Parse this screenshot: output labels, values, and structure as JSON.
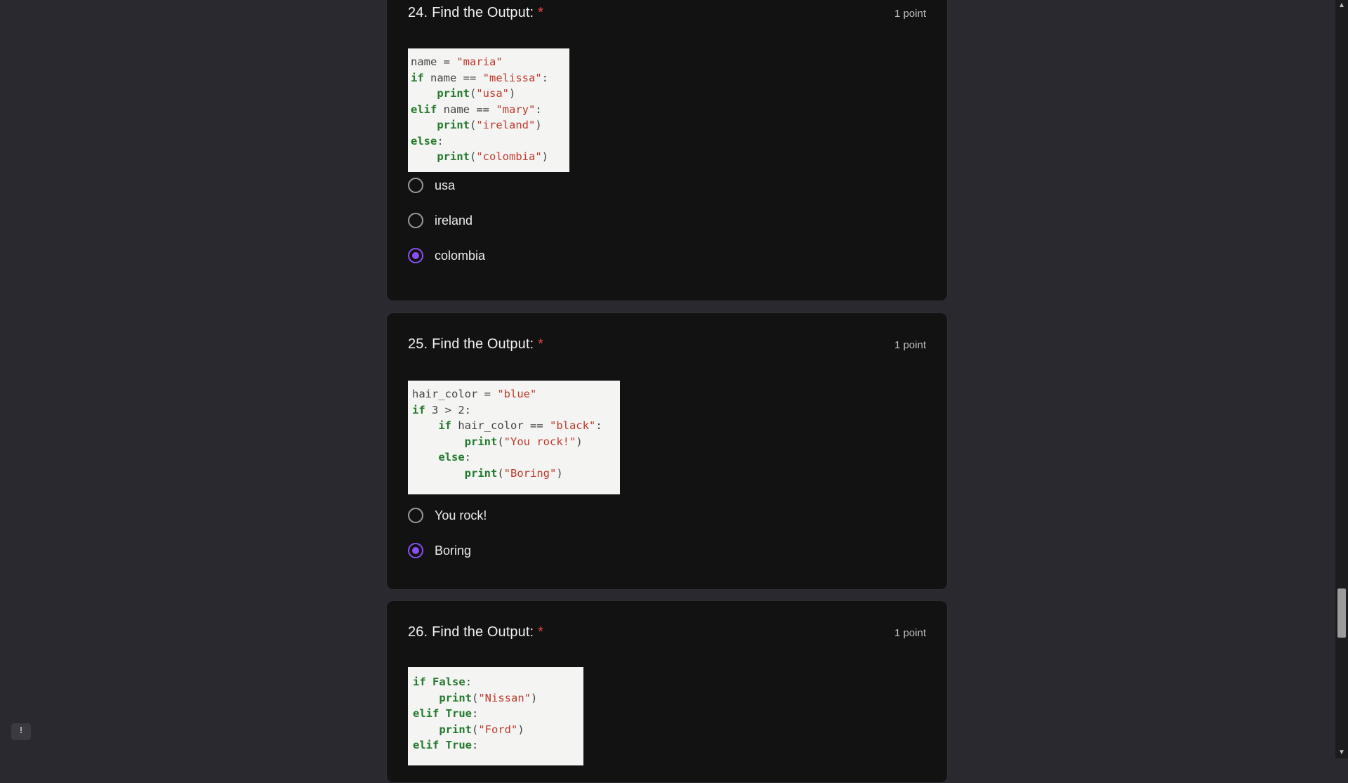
{
  "questions": [
    {
      "number": "24.",
      "title": "Find the Output:",
      "required_mark": "*",
      "points": "1 point",
      "code": [
        [
          {
            "t": "name = ",
            "c": "plain"
          },
          {
            "t": "\"maria\"",
            "c": "str"
          }
        ],
        [
          {
            "t": "if",
            "c": "kw"
          },
          {
            "t": " name == ",
            "c": "plain"
          },
          {
            "t": "\"melissa\"",
            "c": "str"
          },
          {
            "t": ":",
            "c": "plain"
          }
        ],
        [
          {
            "t": "    ",
            "c": "plain"
          },
          {
            "t": "print",
            "c": "kw"
          },
          {
            "t": "(",
            "c": "plain"
          },
          {
            "t": "\"usa\"",
            "c": "str"
          },
          {
            "t": ")",
            "c": "plain"
          }
        ],
        [
          {
            "t": "elif",
            "c": "kw"
          },
          {
            "t": " name == ",
            "c": "plain"
          },
          {
            "t": "\"mary\"",
            "c": "str"
          },
          {
            "t": ":",
            "c": "plain"
          }
        ],
        [
          {
            "t": "    ",
            "c": "plain"
          },
          {
            "t": "print",
            "c": "kw"
          },
          {
            "t": "(",
            "c": "plain"
          },
          {
            "t": "\"ireland\"",
            "c": "str"
          },
          {
            "t": ")",
            "c": "plain"
          }
        ],
        [
          {
            "t": "else",
            "c": "kw"
          },
          {
            "t": ":",
            "c": "plain"
          }
        ],
        [
          {
            "t": "    ",
            "c": "plain"
          },
          {
            "t": "print",
            "c": "kw"
          },
          {
            "t": "(",
            "c": "plain"
          },
          {
            "t": "\"colombia\"",
            "c": "str"
          },
          {
            "t": ")",
            "c": "plain"
          }
        ]
      ],
      "options": [
        {
          "label": "usa",
          "selected": false
        },
        {
          "label": "ireland",
          "selected": false
        },
        {
          "label": "colombia",
          "selected": true
        }
      ]
    },
    {
      "number": "25.",
      "title": "Find the Output:",
      "required_mark": "*",
      "points": "1 point",
      "code": [
        [
          {
            "t": "hair_color = ",
            "c": "plain"
          },
          {
            "t": "\"blue\"",
            "c": "str"
          }
        ],
        [
          {
            "t": "if",
            "c": "kw"
          },
          {
            "t": " 3 > 2:",
            "c": "plain"
          }
        ],
        [
          {
            "t": "    ",
            "c": "plain"
          },
          {
            "t": "if",
            "c": "kw"
          },
          {
            "t": " hair_color == ",
            "c": "plain"
          },
          {
            "t": "\"black\"",
            "c": "str"
          },
          {
            "t": ":",
            "c": "plain"
          }
        ],
        [
          {
            "t": "        ",
            "c": "plain"
          },
          {
            "t": "print",
            "c": "kw"
          },
          {
            "t": "(",
            "c": "plain"
          },
          {
            "t": "\"You rock!\"",
            "c": "str"
          },
          {
            "t": ")",
            "c": "plain"
          }
        ],
        [
          {
            "t": "    ",
            "c": "plain"
          },
          {
            "t": "else",
            "c": "kw"
          },
          {
            "t": ":",
            "c": "plain"
          }
        ],
        [
          {
            "t": "        ",
            "c": "plain"
          },
          {
            "t": "print",
            "c": "kw"
          },
          {
            "t": "(",
            "c": "plain"
          },
          {
            "t": "\"Boring\"",
            "c": "str"
          },
          {
            "t": ")",
            "c": "plain"
          }
        ]
      ],
      "options": [
        {
          "label": "You rock!",
          "selected": false
        },
        {
          "label": "Boring",
          "selected": true
        }
      ]
    },
    {
      "number": "26.",
      "title": "Find the Output:",
      "required_mark": "*",
      "points": "1 point",
      "code": [
        [
          {
            "t": "if",
            "c": "kw"
          },
          {
            "t": " ",
            "c": "plain"
          },
          {
            "t": "False",
            "c": "kw"
          },
          {
            "t": ":",
            "c": "plain"
          }
        ],
        [
          {
            "t": "    ",
            "c": "plain"
          },
          {
            "t": "print",
            "c": "kw"
          },
          {
            "t": "(",
            "c": "plain"
          },
          {
            "t": "\"Nissan\"",
            "c": "str"
          },
          {
            "t": ")",
            "c": "plain"
          }
        ],
        [
          {
            "t": "elif",
            "c": "kw"
          },
          {
            "t": " ",
            "c": "plain"
          },
          {
            "t": "True",
            "c": "kw"
          },
          {
            "t": ":",
            "c": "plain"
          }
        ],
        [
          {
            "t": "    ",
            "c": "plain"
          },
          {
            "t": "print",
            "c": "kw"
          },
          {
            "t": "(",
            "c": "plain"
          },
          {
            "t": "\"Ford\"",
            "c": "str"
          },
          {
            "t": ")",
            "c": "plain"
          }
        ],
        [
          {
            "t": "elif",
            "c": "kw"
          },
          {
            "t": " ",
            "c": "plain"
          },
          {
            "t": "True",
            "c": "kw"
          },
          {
            "t": ":",
            "c": "plain"
          }
        ]
      ],
      "options": []
    }
  ],
  "icons": {
    "feedback": "report-feedback-icon",
    "scroll_up": "scroll-up-arrow-icon",
    "scroll_down": "scroll-down-arrow-icon"
  },
  "scroll": {
    "up_glyph": "▲",
    "down_glyph": "▼",
    "position_fraction": 0.8
  },
  "colors": {
    "page_bg": "#2a2930",
    "card_bg": "#121212",
    "accent": "#8a4ff2",
    "required": "#e64a40"
  }
}
